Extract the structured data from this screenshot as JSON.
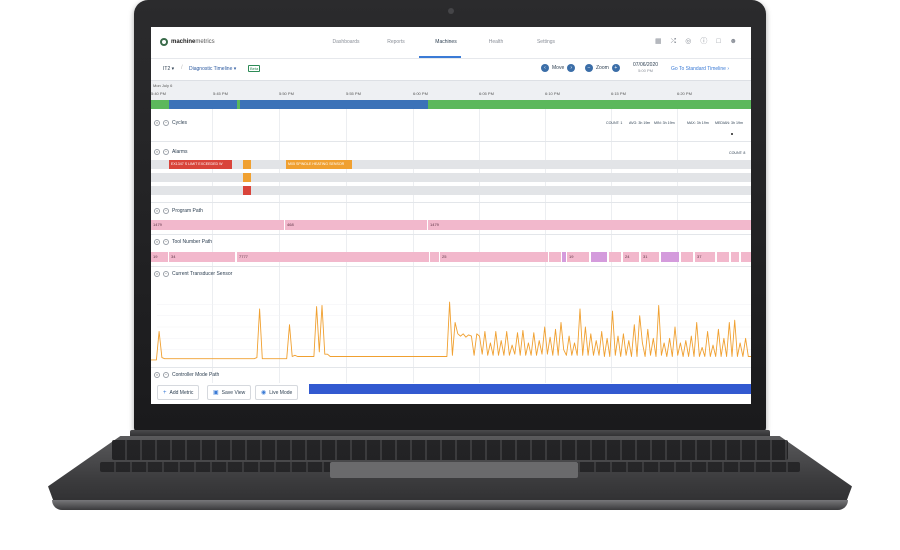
{
  "nav": {
    "logo_bold": "machine",
    "logo_light": "metrics",
    "links": [
      "Dashboards",
      "Reports",
      "Machines",
      "Health",
      "Settings"
    ],
    "active": "Machines",
    "icons": [
      "grid-icon",
      "shuffle-icon",
      "globe-icon",
      "help-icon",
      "lock-icon",
      "user-icon"
    ]
  },
  "subbar": {
    "machine": "IT2",
    "view": "Diagnostic Timeline",
    "badge": "Beta",
    "move": "Move",
    "zoom": "Zoom",
    "date": "07/06/2020",
    "time": "5:00 PM",
    "standard_link": "Go To Standard Timeline"
  },
  "ruler": {
    "date_label": "Mon July 6",
    "ticks": [
      "5:40 PM",
      "5:45 PM",
      "5:50 PM",
      "5:55 PM",
      "6:00 PM",
      "6:05 PM",
      "6:10 PM",
      "6:15 PM",
      "6:20 PM"
    ]
  },
  "status_colors": {
    "active": "#5cb85c",
    "idle": "#3b72b8"
  },
  "sections": {
    "cycles": "Cycles",
    "alarms": "Alarms",
    "program_path": "Program Path",
    "tool_number_path": "Tool Number Path",
    "current_transducer": "Current Transducer Sensor",
    "controller_mode": "Controller Mode Path"
  },
  "cycle_stats": {
    "count": "COUNT: 1",
    "avg": "AVG: 3h 19m",
    "min": "MIN: 3h 19m",
    "max": "MAX: 3h 19m",
    "median": "MEDIAN: 3h 19m"
  },
  "alarm_count": "COUNT: 8",
  "alarms": {
    "alarm1": "EX1347 S LIMIT EXCEEDED W",
    "alarm2": "M05 SPINDLE HEATING SENSOR"
  },
  "program_path": [
    "1479",
    "468",
    "1479"
  ],
  "tool_numbers": [
    "19",
    "34",
    "7777",
    "25",
    "19",
    "24",
    "31",
    "37"
  ],
  "chart_data": {
    "type": "line",
    "title": "",
    "xlabel": "",
    "ylabel": "",
    "ylim": [
      0,
      6
    ],
    "series": [
      {
        "color": "#f0a030",
        "values": [
          0.1,
          0.1,
          0.1,
          2.6,
          0.3,
          0.2,
          0.2,
          0.2,
          0.2,
          0.2,
          0.2,
          0.2,
          0.2,
          0.2,
          0.2,
          0.2,
          0.2,
          0.2,
          0.2,
          0.2,
          0.2,
          0.2,
          0.2,
          0.2,
          0.2,
          0.2,
          0.2,
          0.2,
          0.2,
          0.2,
          0.2,
          0.2,
          0.2,
          0.2,
          0.2,
          0.2,
          0.2,
          0.2,
          0.2,
          0.3,
          4.6,
          0.2,
          0.2,
          0.2,
          0.2,
          0.2,
          0.2,
          0.2,
          0.2,
          0.2,
          0.2,
          3.2,
          0.4,
          0.5,
          0.4,
          0.4,
          0.4,
          0.4,
          0.4,
          0.4,
          0.4,
          4.8,
          0.8,
          4.9,
          0.6,
          0.6,
          0.4,
          0.4,
          0.4,
          0.4,
          0.4,
          0.4,
          0.4,
          0.4,
          0.4,
          0.4,
          0.4,
          0.4,
          0.4,
          0.4,
          0.4,
          0.4,
          0.4,
          0.4,
          0.4,
          0.4,
          0.4,
          0.4,
          0.4,
          0.4,
          0.4,
          0.4,
          0.4,
          0.4,
          0.4,
          0.4,
          0.4,
          0.4,
          0.4,
          0.4,
          0.4,
          0.4,
          0.4,
          0.4,
          0.4,
          0.4,
          0.4,
          0.4,
          0.4,
          0.4,
          5.2,
          0.5,
          3.4,
          2.4,
          2.2,
          2.4,
          2.1,
          2.3,
          2.2,
          0.5,
          2.4,
          2.2,
          0.6,
          2.6,
          0.5,
          1.6,
          0.5,
          2.6,
          0.5,
          1.8,
          0.5,
          2.6,
          0.5,
          1.4,
          0.6,
          2.5,
          0.5,
          2.7,
          0.5,
          1.6,
          0.5,
          2.5,
          0.5,
          1.8,
          0.6,
          3.0,
          0.6,
          2.1,
          0.5,
          2.8,
          0.5,
          3.4,
          1.0,
          0.5,
          2.2,
          0.5,
          1.6,
          0.5,
          4.6,
          0.5,
          3.0,
          0.5,
          2.4,
          0.5,
          1.8,
          0.5,
          2.6,
          0.4,
          2.0,
          0.4,
          4.4,
          0.5,
          2.2,
          0.4,
          2.4,
          0.5,
          1.8,
          0.4,
          3.2,
          0.4,
          4.0,
          1.6,
          0.4,
          2.8,
          0.5,
          2.0,
          0.4,
          4.9,
          0.5,
          1.6,
          0.4,
          2.0,
          0.4,
          3.0,
          0.5,
          1.6,
          0.4,
          1.8,
          0.4,
          2.2,
          0.4,
          3.4,
          0.4,
          1.2,
          0.4,
          2.6,
          0.4,
          1.4,
          0.4,
          2.8,
          0.4,
          2.0,
          0.4,
          3.4,
          0.4,
          3.6,
          0.4,
          1.6,
          0.4,
          2.0,
          0.4,
          0.4
        ]
      }
    ]
  },
  "bottom": {
    "add_metric": "Add Metric",
    "save_view": "Save View",
    "live_mode": "Live Mode"
  }
}
